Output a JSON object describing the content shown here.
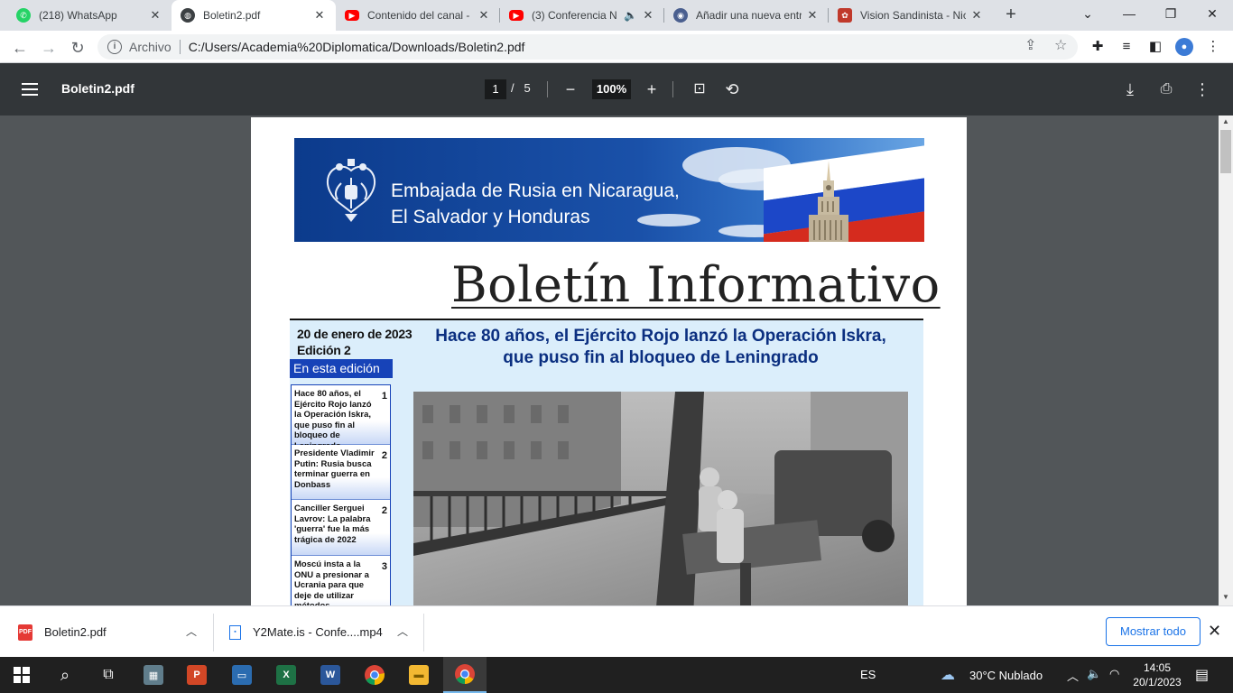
{
  "browser": {
    "tabs": [
      {
        "title": "(218) WhatsApp",
        "icon": "whatsapp-icon",
        "active": false
      },
      {
        "title": "Boletin2.pdf",
        "icon": "globe-icon",
        "active": true
      },
      {
        "title": "Contenido del canal -",
        "icon": "youtube-icon",
        "active": false
      },
      {
        "title": "(3) Conferencia N",
        "icon": "youtube-icon",
        "active": false
      },
      {
        "title": "Añadir una nueva entr",
        "icon": "site-icon",
        "active": false
      },
      {
        "title": "Vision Sandinista - Nic",
        "icon": "site-icon",
        "active": false
      }
    ],
    "new_tab": "+",
    "address": {
      "scheme": "Archivo",
      "url": "C:/Users/Academia%20Diplomatica/Downloads/Boletin2.pdf"
    }
  },
  "pdf_viewer": {
    "title": "Boletin2.pdf",
    "current_page": "1",
    "separator": "/",
    "total_pages": "5",
    "zoom": "100%"
  },
  "document": {
    "banner_line1": "Embajada de Rusia en Nicaragua,",
    "banner_line2": "El Salvador y Honduras",
    "bulletin_title": "Boletín Informativo",
    "date": "20 de enero de 2023",
    "edition": "Edición  2",
    "in_this_edition": "En esta edición",
    "headline_line1": "Hace 80 años, el Ejército Rojo lanzó la Operación Iskra,",
    "headline_line2": "que puso fin al bloqueo de Leningrado",
    "toc": [
      {
        "text": "Hace 80 años, el Ejército Rojo lanzó la Operación Iskra, que puso fin al bloqueo de Leningrado",
        "page": "1"
      },
      {
        "text": "Presidente Vladimir Putin: Rusia busca terminar guerra en Donbass",
        "page": "2"
      },
      {
        "text": "Canciller Serguei Lavrov: La palabra 'guerra' fue la más trágica de 2022",
        "page": "2"
      },
      {
        "text": "Moscú insta a la ONU a presionar a Ucrania para que deje de utilizar métodos",
        "page": "3"
      }
    ]
  },
  "downloads": {
    "items": [
      {
        "name": "Boletin2.pdf",
        "icon": "pdf-file-icon"
      },
      {
        "name": "Y2Mate.is - Confe....mp4",
        "icon": "video-file-icon"
      }
    ],
    "show_all": "Mostrar todo"
  },
  "taskbar": {
    "language": "ES",
    "weather": "30°C  Nublado",
    "time": "14:05",
    "date": "20/1/2023"
  },
  "colors": {
    "pdf_toolbar": "#323639",
    "headline": "#0b2f80",
    "edition_badge": "#1743b8",
    "content_background": "#dbeefb"
  }
}
